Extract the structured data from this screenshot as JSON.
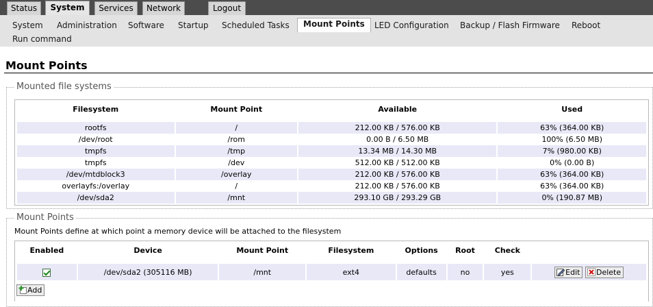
{
  "top_tabs": [
    {
      "label": "Status",
      "active": false
    },
    {
      "label": "System",
      "active": true
    },
    {
      "label": "Services",
      "active": false
    },
    {
      "label": "Network",
      "active": false
    },
    {
      "label": "Logout",
      "active": false
    }
  ],
  "submenu": [
    {
      "label": "System"
    },
    {
      "label": "Administration"
    },
    {
      "label": "Software"
    },
    {
      "label": "Startup"
    },
    {
      "label": "Scheduled Tasks"
    },
    {
      "label": "Mount Points",
      "active": true
    },
    {
      "label": "LED Configuration"
    },
    {
      "label": "Backup / Flash Firmware"
    },
    {
      "label": "Reboot"
    },
    {
      "label": "Run command"
    }
  ],
  "page": {
    "title": "Mount Points"
  },
  "mounted": {
    "legend": "Mounted file systems",
    "columns": [
      "Filesystem",
      "Mount Point",
      "Available",
      "Used"
    ],
    "rows": [
      [
        "rootfs",
        "/",
        "212.00 KB / 576.00 KB",
        "63% (364.00 KB)"
      ],
      [
        "/dev/root",
        "/rom",
        "0.00 B / 6.50 MB",
        "100% (6.50 MB)"
      ],
      [
        "tmpfs",
        "/tmp",
        "13.34 MB / 14.30 MB",
        "7% (980.00 KB)"
      ],
      [
        "tmpfs",
        "/dev",
        "512.00 KB / 512.00 KB",
        "0% (0.00 B)"
      ],
      [
        "/dev/mtdblock3",
        "/overlay",
        "212.00 KB / 576.00 KB",
        "63% (364.00 KB)"
      ],
      [
        "overlayfs:/overlay",
        "/",
        "212.00 KB / 576.00 KB",
        "63% (364.00 KB)"
      ],
      [
        "/dev/sda2",
        "/mnt",
        "293.10 GB / 293.29 GB",
        "0% (190.87 MB)"
      ]
    ]
  },
  "mountpoints": {
    "legend": "Mount Points",
    "description": "Mount Points define at which point a memory device will be attached to the filesystem",
    "columns": [
      "Enabled",
      "Device",
      "Mount Point",
      "Filesystem",
      "Options",
      "Root",
      "Check"
    ],
    "rows": [
      {
        "enabled": true,
        "device": "/dev/sda2 (305116 MB)",
        "mount_point": "/mnt",
        "filesystem": "ext4",
        "options": "defaults",
        "root": "no",
        "check": "yes"
      }
    ],
    "edit_label": "Edit",
    "delete_label": "Delete",
    "add_label": "Add"
  },
  "colors": {
    "topbar": "#4c4c4c",
    "odd_row": "#e8e8f7",
    "submenu_bg": "#e3e3e3"
  }
}
